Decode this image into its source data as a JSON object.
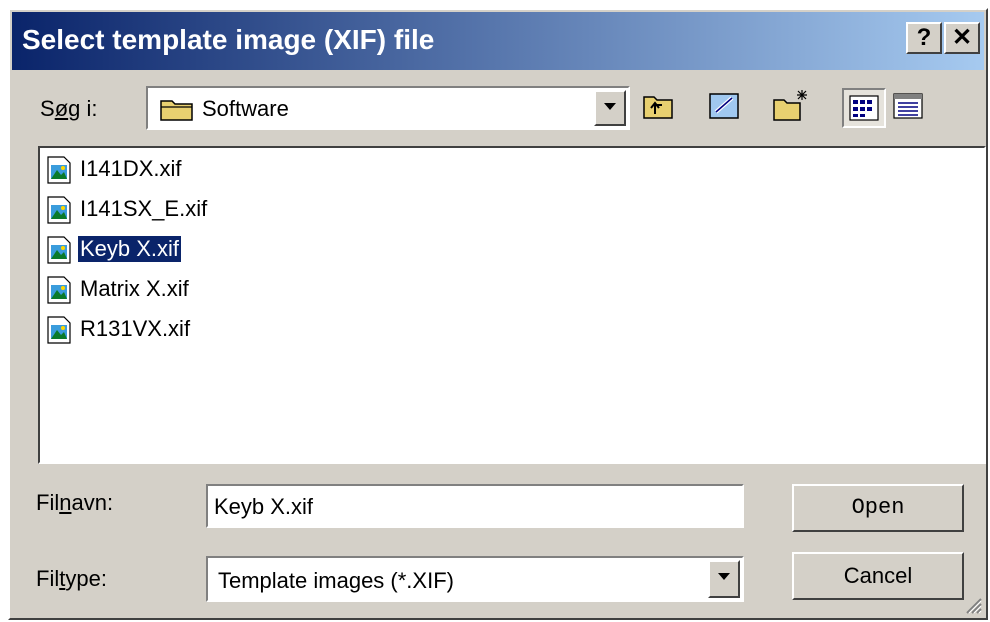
{
  "dialog": {
    "title": "Select template image (XIF) file",
    "help_button": "?",
    "close_button": "✕"
  },
  "look_in": {
    "label_pre": "S",
    "label_ul": "ø",
    "label_post": "g i:",
    "value": "Software"
  },
  "toolbar": {
    "icons": [
      "up-folder-icon",
      "desktop-icon",
      "new-folder-icon",
      "list-view-icon",
      "details-view-icon"
    ]
  },
  "files": [
    {
      "name": "I141DX.xif",
      "selected": false
    },
    {
      "name": "I141SX_E.xif",
      "selected": false
    },
    {
      "name": "Keyb X.xif",
      "selected": true
    },
    {
      "name": "Matrix X.xif",
      "selected": false
    },
    {
      "name": "R131VX.xif",
      "selected": false
    }
  ],
  "filename": {
    "label_pre": "Fil",
    "label_ul": "n",
    "label_post": "avn:",
    "value": "Keyb X.xif"
  },
  "filetype": {
    "label_pre": "Fil",
    "label_ul": "t",
    "label_post": "ype:",
    "value": "Template images (*.XIF)"
  },
  "buttons": {
    "open": "Open",
    "cancel": "Cancel"
  }
}
